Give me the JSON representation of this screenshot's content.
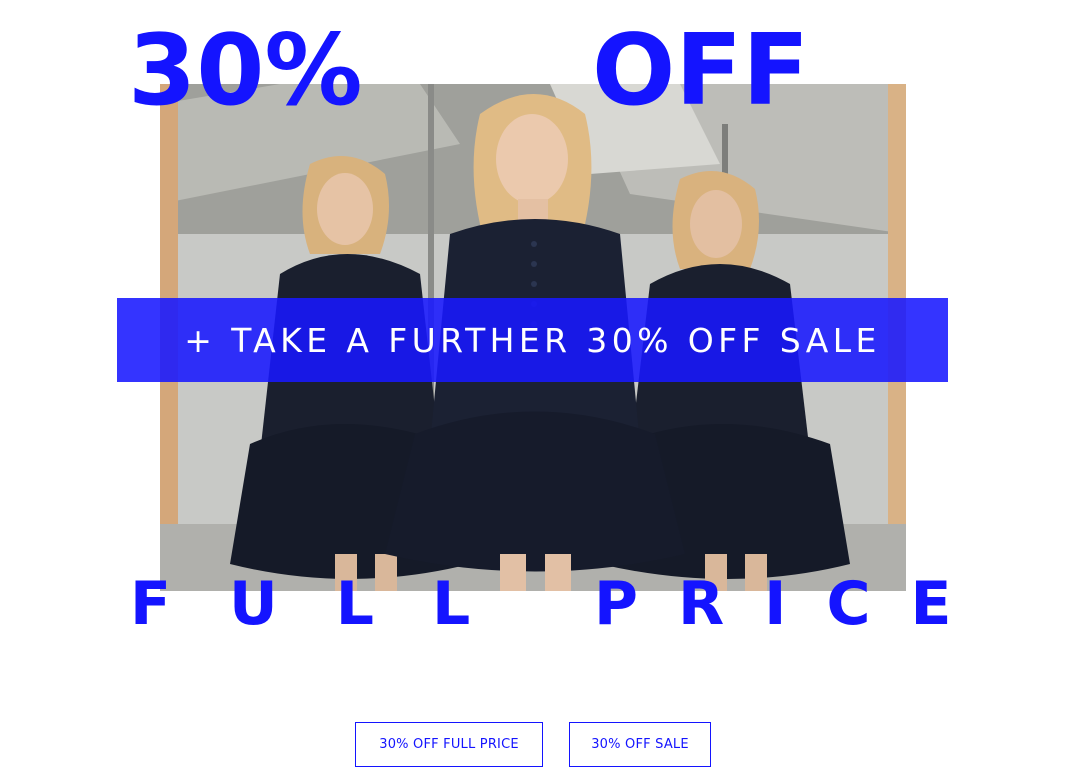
{
  "hero": {
    "headline_top_left": "30%",
    "headline_top_right": "OFF",
    "headline_bottom_left": "FULL",
    "headline_bottom_right": "PRICE",
    "banner_text": "+ TAKE A FURTHER 30% OFF SALE"
  },
  "actions": {
    "full_price_label": "30% OFF FULL PRICE",
    "sale_label": "30% OFF SALE"
  },
  "colors": {
    "accent": "#1414ff",
    "background": "#ffffff",
    "banner_text": "#ffffff"
  }
}
